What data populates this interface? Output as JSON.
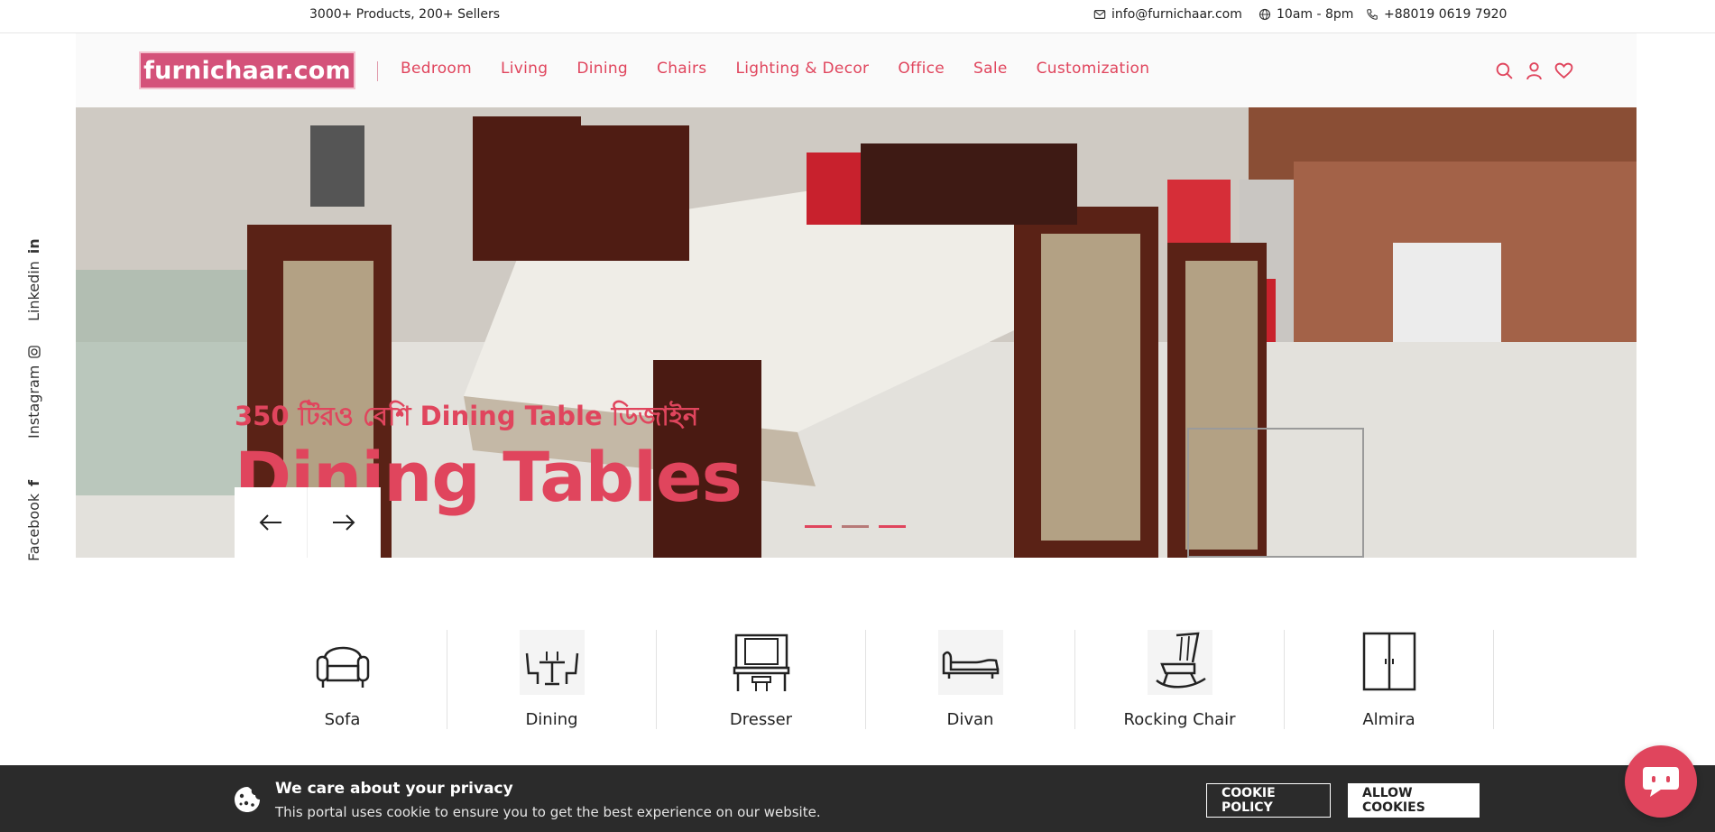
{
  "topbar": {
    "promo": "3000+ Products, 200+ Sellers",
    "email": "info@furnichaar.com",
    "hours": "10am - 8pm",
    "phone": "+88019 0619 7920"
  },
  "header": {
    "logo_text": "furnichaar.com",
    "nav": [
      "Bedroom",
      "Living",
      "Dining",
      "Chairs",
      "Lighting & Decor",
      "Office",
      "Sale",
      "Customization"
    ],
    "icons": [
      "search-icon",
      "user-icon",
      "heart-icon"
    ]
  },
  "hero": {
    "subtitle": "350 টিরও বেশি Dining Table ডিজাইন",
    "title": "Dining Tables",
    "slides": 3,
    "active_slide": 1
  },
  "social": [
    "Linkedin",
    "Instagram",
    "Facebook"
  ],
  "categories": [
    {
      "label": "Sofa",
      "icon": "sofa-icon"
    },
    {
      "label": "Dining",
      "icon": "dining-icon"
    },
    {
      "label": "Dresser",
      "icon": "dresser-icon"
    },
    {
      "label": "Divan",
      "icon": "divan-icon"
    },
    {
      "label": "Rocking Chair",
      "icon": "rocking-chair-icon"
    },
    {
      "label": "Almira",
      "icon": "almira-icon"
    }
  ],
  "cookie": {
    "title": "We care about your privacy",
    "text": "This portal uses cookie to ensure you to get the best experience on our website.",
    "policy_label": "COOKIE POLICY",
    "allow_label": "ALLOW COOKIES"
  },
  "colors": {
    "accent": "#e0455d",
    "logo_bg": "#d4527a",
    "cookie_bg": "#2b2b2b"
  }
}
